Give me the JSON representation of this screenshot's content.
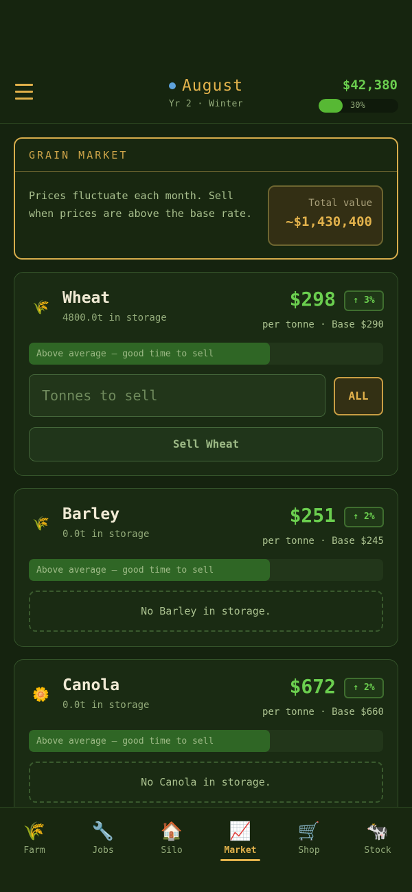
{
  "header": {
    "month": "August",
    "year_season": "Yr 2 · Winter",
    "money": "$42,380",
    "progress_pct": 30,
    "progress_label": "30%"
  },
  "market": {
    "title": "GRAIN MARKET",
    "description": "Prices fluctuate each month. Sell when prices are above the base rate.",
    "total_label": "Total value",
    "total_value": "~$1,430,400"
  },
  "grains": [
    {
      "icon": "🌾",
      "name": "Wheat",
      "storage": "4800.0t in storage",
      "price": "$298",
      "change": "↑ 3%",
      "per": "per tonne · Base $290",
      "bar_label": "Above average — good time to sell",
      "bar_fill": 0.68,
      "input_placeholder": "Tonnes to sell",
      "all_label": "ALL",
      "sell_label": "Sell Wheat"
    },
    {
      "icon": "🌾",
      "name": "Barley",
      "storage": "0.0t in storage",
      "price": "$251",
      "change": "↑ 2%",
      "per": "per tonne · Base $245",
      "bar_label": "Above average — good time to sell",
      "bar_fill": 0.68,
      "empty_label": "No Barley in storage."
    },
    {
      "icon": "🌼",
      "name": "Canola",
      "storage": "0.0t in storage",
      "price": "$672",
      "change": "↑ 2%",
      "per": "per tonne · Base $660",
      "bar_label": "Above average — good time to sell",
      "bar_fill": 0.68,
      "empty_label": "No Canola in storage."
    }
  ],
  "nav": [
    {
      "icon": "🌾",
      "label": "Farm"
    },
    {
      "icon": "🔧",
      "label": "Jobs"
    },
    {
      "icon": "🏠",
      "label": "Silo"
    },
    {
      "icon": "📈",
      "label": "Market"
    },
    {
      "icon": "🛒",
      "label": "Shop"
    },
    {
      "icon": "🐄",
      "label": "Stock"
    }
  ],
  "colors": {
    "background": "#15230f",
    "accent_gold": "#e2b24c",
    "accent_green": "#6bcf4f"
  }
}
